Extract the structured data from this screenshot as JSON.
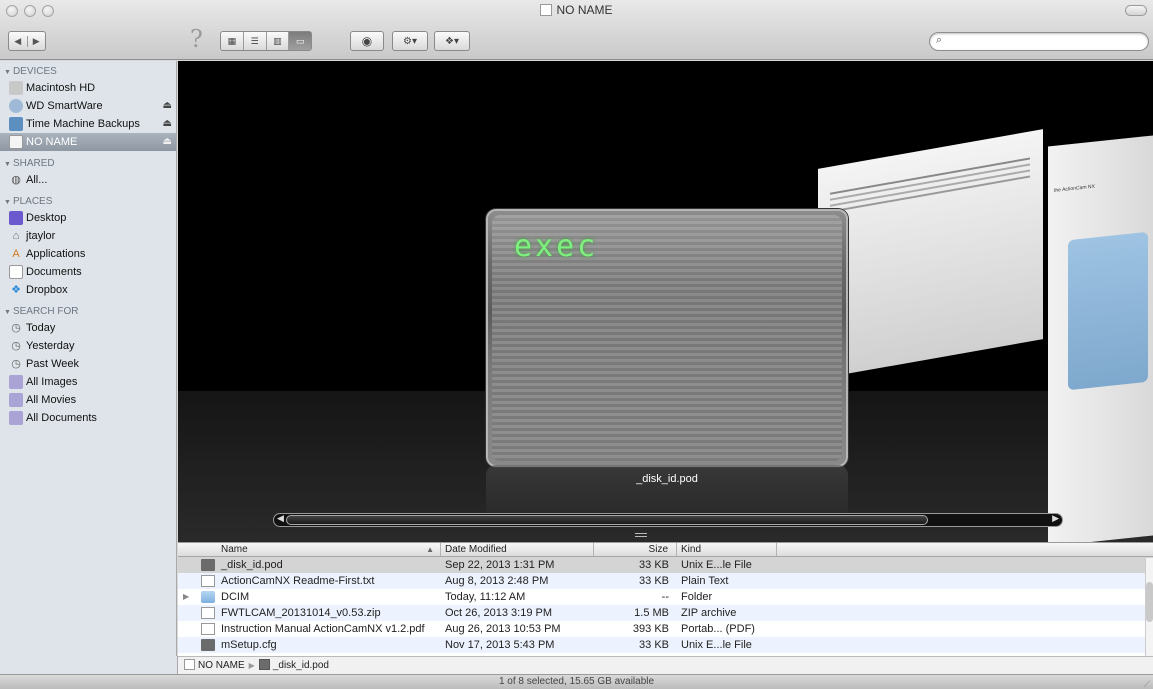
{
  "window": {
    "title": "NO NAME"
  },
  "toolbar": {
    "back_label": "◀",
    "forward_label": "▶",
    "help_glyph": "?",
    "view_modes": [
      "icon-view",
      "list-view",
      "column-view",
      "coverflow-view"
    ],
    "active_view": "coverflow-view"
  },
  "search": {
    "placeholder": "",
    "value": ""
  },
  "sidebar": {
    "devices_header": "DEVICES",
    "devices": [
      {
        "label": "Macintosh HD",
        "icon": "hard-drive-icon"
      },
      {
        "label": "WD SmartWare",
        "icon": "external-disk-icon",
        "eject": true
      },
      {
        "label": "Time Machine Backups",
        "icon": "time-machine-icon",
        "eject": true
      },
      {
        "label": "NO NAME",
        "icon": "removable-disk-icon",
        "eject": true,
        "selected": true
      }
    ],
    "shared_header": "SHARED",
    "shared": [
      {
        "label": "All...",
        "icon": "network-icon"
      }
    ],
    "places_header": "PLACES",
    "places": [
      {
        "label": "Desktop",
        "icon": "desktop-icon"
      },
      {
        "label": "jtaylor",
        "icon": "home-icon"
      },
      {
        "label": "Applications",
        "icon": "applications-icon"
      },
      {
        "label": "Documents",
        "icon": "documents-icon"
      },
      {
        "label": "Dropbox",
        "icon": "dropbox-icon"
      }
    ],
    "search_header": "SEARCH FOR",
    "search_for": [
      {
        "label": "Today",
        "icon": "clock-icon"
      },
      {
        "label": "Yesterday",
        "icon": "clock-icon"
      },
      {
        "label": "Past Week",
        "icon": "clock-icon"
      },
      {
        "label": "All Images",
        "icon": "smart-folder-icon"
      },
      {
        "label": "All Movies",
        "icon": "smart-folder-icon"
      },
      {
        "label": "All Documents",
        "icon": "smart-folder-icon"
      }
    ]
  },
  "coverflow": {
    "current_label": "_disk_id.pod",
    "cover_text": "exec",
    "page_heading": "the ActionCam NX"
  },
  "list": {
    "columns": {
      "name": "Name",
      "date": "Date Modified",
      "size": "Size",
      "kind": "Kind"
    },
    "rows": [
      {
        "name": "_disk_id.pod",
        "date": "Sep 22, 2013 1:31 PM",
        "size": "33 KB",
        "kind": "Unix E...le File",
        "icon": "exec-file-icon",
        "selected": true
      },
      {
        "name": "ActionCamNX Readme-First.txt",
        "date": "Aug 8, 2013 2:48 PM",
        "size": "33 KB",
        "kind": "Plain Text",
        "icon": "text-file-icon"
      },
      {
        "name": "DCIM",
        "date": "Today, 11:12 AM",
        "size": "--",
        "kind": "Folder",
        "icon": "folder-icon",
        "folder": true
      },
      {
        "name": "FWTLCAM_20131014_v0.53.zip",
        "date": "Oct 26, 2013 3:19 PM",
        "size": "1.5 MB",
        "kind": "ZIP archive",
        "icon": "zip-file-icon"
      },
      {
        "name": "Instruction Manual ActionCamNX v1.2.pdf",
        "date": "Aug 26, 2013 10:53 PM",
        "size": "393 KB",
        "kind": "Portab... (PDF)",
        "icon": "pdf-file-icon"
      },
      {
        "name": "mSetup.cfg",
        "date": "Nov 17, 2013 5:43 PM",
        "size": "33 KB",
        "kind": "Unix E...le File",
        "icon": "exec-file-icon"
      }
    ]
  },
  "pathbar": {
    "volume": "NO NAME",
    "file": "_disk_id.pod"
  },
  "status": {
    "text": "1 of 8 selected, 15.65 GB available"
  }
}
